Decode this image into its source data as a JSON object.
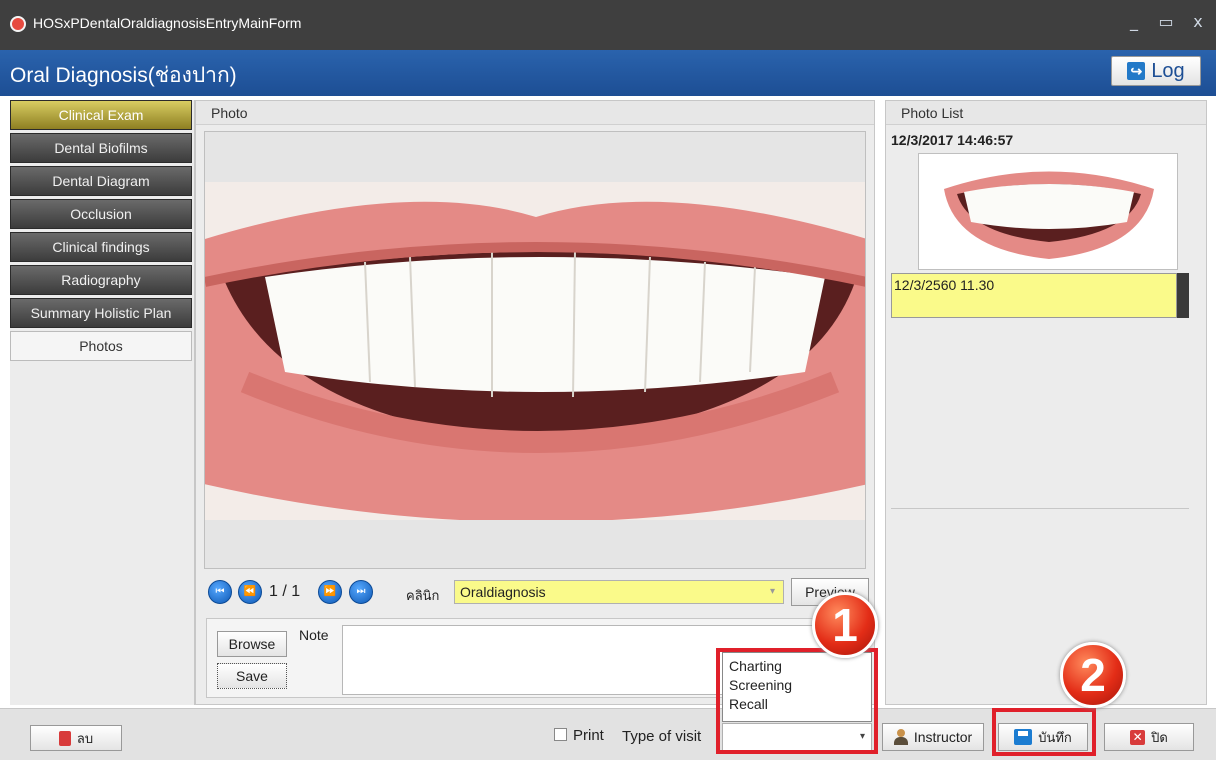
{
  "window": {
    "title": "HOSxPDentalOraldiagnosisEntryMainForm",
    "controls": [
      "_",
      "▭",
      "x"
    ]
  },
  "header": {
    "title": "Oral Diagnosis(ช่องปาก)",
    "log_label": "Log"
  },
  "sidebar": {
    "items": [
      {
        "label": "Clinical Exam"
      },
      {
        "label": "Dental Biofilms"
      },
      {
        "label": "Dental Diagram"
      },
      {
        "label": "Occlusion"
      },
      {
        "label": "Clinical findings"
      },
      {
        "label": "Radiography"
      },
      {
        "label": "Summary Holistic Plan"
      },
      {
        "label": "Photos"
      }
    ],
    "active_item": "Photos",
    "highlight_item": "Clinical Exam"
  },
  "photo_panel": {
    "title": "Photo",
    "page_indicator": "1 / 1",
    "clinic_label": "คลินิก",
    "clinic_value": "Oraldiagnosis",
    "preview_label": "Preview",
    "browse_label": "Browse",
    "save_label": "Save",
    "note_label": "Note",
    "note_value": ""
  },
  "photo_list": {
    "title": "Photo List",
    "entries": [
      {
        "date": "12/3/2017 14:46:57",
        "note": "12/3/2560 11.30"
      }
    ]
  },
  "statusbar": {
    "delete_label": "ลบ",
    "print_label": "Print",
    "print_checked": false,
    "type_of_visit_label": "Type of visit",
    "type_of_visit_options": [
      "Charting",
      "Screening",
      "Recall"
    ],
    "type_of_visit_value": "",
    "instructor_label": "Instructor",
    "record_label": "บันทึก",
    "close_label": "ปิด"
  },
  "annotations": {
    "badge_1": "1",
    "badge_2": "2",
    "highlight_color": "#e0202a"
  },
  "colors": {
    "header_bg": "#1d4e94",
    "field_yellow": "#fafa8a",
    "titlebar_bg": "#3f3f3f"
  }
}
